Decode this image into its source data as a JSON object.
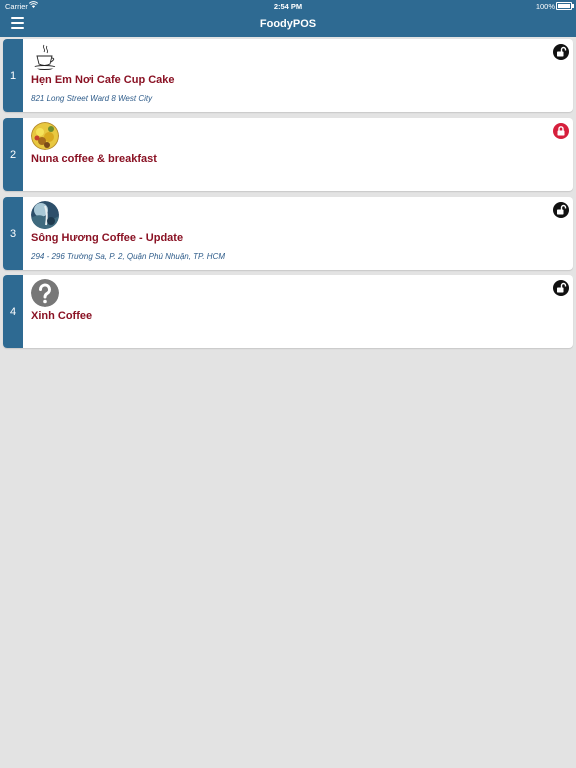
{
  "status_bar": {
    "carrier": "Carrier",
    "time": "2:54 PM",
    "battery": "100%"
  },
  "nav": {
    "title": "FoodyPOS"
  },
  "stores": [
    {
      "index": "1",
      "name": "Hẹn Em Nơi Cafe Cup Cake",
      "address": "821 Long Street Ward 8 West City",
      "lock": "unlocked"
    },
    {
      "index": "2",
      "name": "Nuna coffee & breakfast",
      "address": "",
      "lock": "locked"
    },
    {
      "index": "3",
      "name": "Sông Hương Coffee - Update",
      "address": "294 - 296 Trường Sa, P. 2,  Quận Phú Nhuận, TP. HCM",
      "lock": "unlocked"
    },
    {
      "index": "4",
      "name": "Xinh Coffee",
      "address": "",
      "lock": "unlocked"
    }
  ],
  "colors": {
    "header": "#2e6a92",
    "name_text": "#8a1224",
    "address_text": "#2e5c8a",
    "locked": "#d61f3c",
    "unlocked": "#111111"
  },
  "icons": {
    "menu": "hamburger-menu-icon",
    "unlocked": "unlocked-padlock-icon",
    "locked": "locked-padlock-icon"
  }
}
